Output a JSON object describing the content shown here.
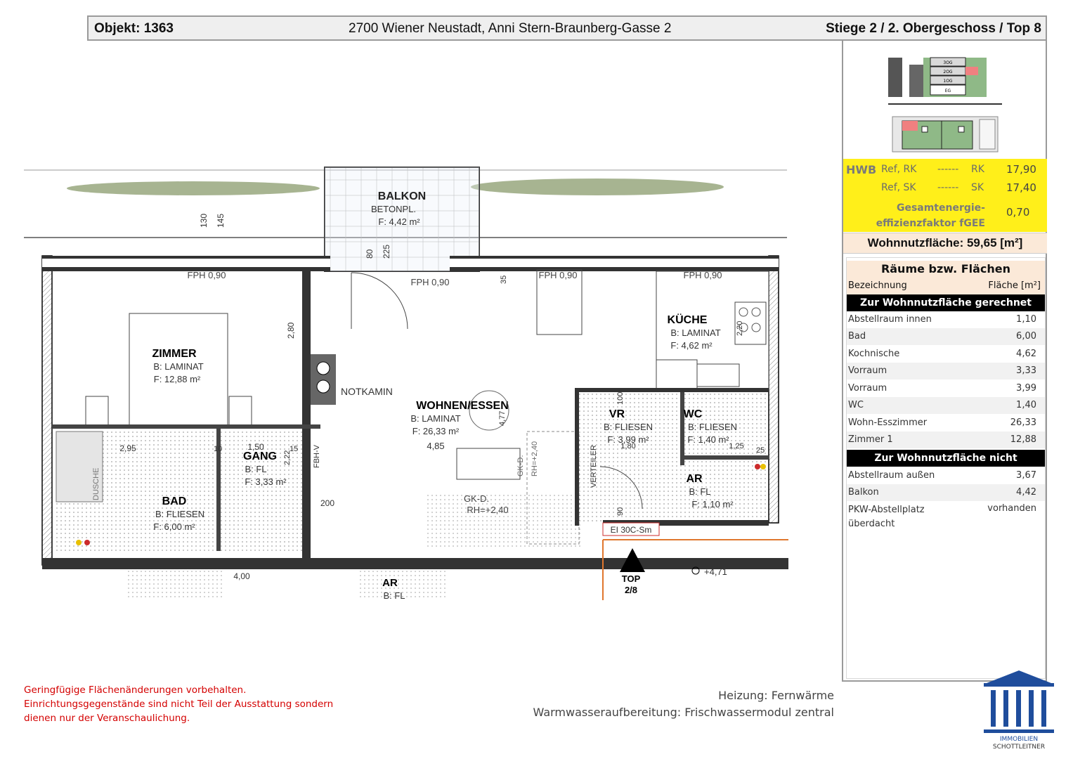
{
  "header": {
    "objekt_label": "Objekt:  1363",
    "address": "2700 Wiener Neustadt, Anni Stern-Braunberg-Gasse 2",
    "unit": "Stiege 2 / 2. Obergeschoss / Top 8"
  },
  "thumbnail": {
    "floors": [
      "3OG",
      "2OG",
      "1OG",
      "EG"
    ]
  },
  "hwb": {
    "label": "HWB",
    "ref_rk": "Ref, RK",
    "dash1": "------",
    "rk": "RK",
    "rk_value": "17,90",
    "ref_sk": "Ref, SK",
    "dash2": "------",
    "sk": "SK",
    "sk_value": "17,40",
    "fgee_line1": "Gesamtenergie-",
    "fgee_line2": "effizienzfaktor fGEE",
    "fgee_value": "0,70",
    "color": "#ffef1a"
  },
  "wohnnutzflaeche": "Wohnnutzfläche: 59,65 [m²]",
  "rooms_table": {
    "title": "Räume bzw. Flächen",
    "col_name": "Bezeichnung",
    "col_area": "Fläche [m²]",
    "section1": "Zur Wohnnutzfläche gerechnet",
    "rows1": [
      {
        "name": "Abstellraum innen",
        "value": "1,10"
      },
      {
        "name": "Bad",
        "value": "6,00"
      },
      {
        "name": "Kochnische",
        "value": "4,62"
      },
      {
        "name": "Vorraum",
        "value": "3,33"
      },
      {
        "name": "Vorraum",
        "value": "3,99"
      },
      {
        "name": "WC",
        "value": "1,40"
      },
      {
        "name": "Wohn-Esszimmer",
        "value": "26,33"
      },
      {
        "name": "Zimmer 1",
        "value": "12,88"
      }
    ],
    "section2": "Zur Wohnnutzfläche nicht gerechnet",
    "rows2": [
      {
        "name": "Abstellraum außen",
        "value": "3,67"
      },
      {
        "name": "Balkon",
        "value": "4,42"
      }
    ],
    "parking_name": "PKW-Abstellplatz überdacht",
    "parking_value": "vorhanden"
  },
  "plan": {
    "balkon": {
      "name": "BALKON",
      "floor": "BETONPL.",
      "area": "F: 4,42 m²"
    },
    "zimmer": {
      "name": "ZIMMER",
      "floor": "B: LAMINAT",
      "area": "F: 12,88 m²"
    },
    "wohnen": {
      "name": "WOHNEN/ESSEN",
      "floor": "B: LAMINAT",
      "area": "F: 26,33 m²"
    },
    "kueche": {
      "name": "KÜCHE",
      "floor": "B: LAMINAT",
      "area": "F: 4,62 m²"
    },
    "vr": {
      "name": "VR",
      "floor": "B: FLIESEN",
      "area": "F: 3,99 m²"
    },
    "wc": {
      "name": "WC",
      "floor": "B: FLIESEN",
      "area": "F: 1,40 m²"
    },
    "gang": {
      "name": "GANG",
      "floor": "B: FL",
      "area": "F: 3,33 m²"
    },
    "bad": {
      "name": "BAD",
      "floor": "B: FLIESEN",
      "area": "F: 6,00 m²"
    },
    "ar": {
      "name": "AR",
      "floor": "B: FL",
      "area": "F: 1,10 m²"
    },
    "ar_below": {
      "name": "AR",
      "floor": "B: FL"
    },
    "notkamin": "NOTKAMIN",
    "fph": "FPH 0,90",
    "dusche": "DUSCHE",
    "verteiler": "VERTEILER",
    "fbh": "FBH-V",
    "gkd1": "GK-D.",
    "gkd1_rh": "RH=+2,40",
    "gkd2": "GK-D.",
    "gkd2_rh": "RH=+2,40",
    "ei30": "EI 30C-Sm",
    "top_label": "TOP",
    "top_num": "2/8",
    "level": "+4,71",
    "dims": {
      "d130": "130",
      "d145": "145",
      "d80": "80",
      "d225": "225",
      "d35": "35",
      "d280": "2,80",
      "d220": "2,20",
      "d477": "4,77",
      "d485": "4,85",
      "d295": "2,95",
      "d150": "1,50",
      "d180": "1,80",
      "d125": "1,25",
      "d200": "200",
      "d10": "10",
      "d15": "15",
      "d100": "100",
      "d90": "90",
      "d400": "4,00",
      "d222": "2,22",
      "d25": "25"
    }
  },
  "disclaimer": [
    "Geringfügige Flächenänderungen vorbehalten.",
    "Einrichtungsgegenstände sind nicht Teil der Ausstattung sondern",
    "dienen nur der Veranschaulichung."
  ],
  "heizung": "Heizung: Fernwärme",
  "warmwasser": "Warmwasseraufbereitung: Frischwassermodul zentral",
  "logo": {
    "line1": "IMMOBILIEN",
    "line2": "SCHOTTLEITNER",
    "color": "#1f4d9c"
  }
}
